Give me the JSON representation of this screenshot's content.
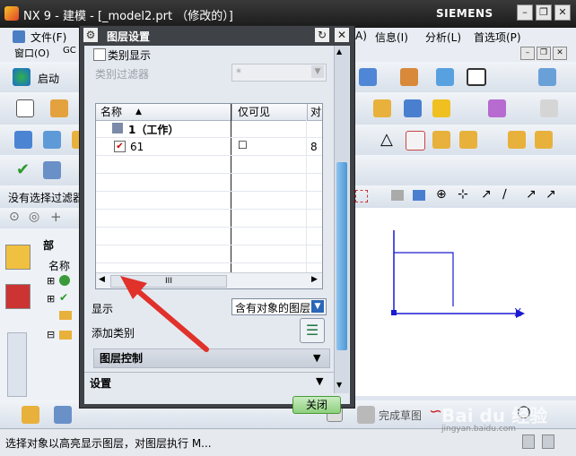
{
  "window": {
    "title": "NX 9 - 建模 - [_model2.prt （修改的）]",
    "brand": "SIEMENS"
  },
  "menubar": {
    "row1": [
      "文件(F)",
      "信息(I)",
      "分析(L)",
      "首选项(P)"
    ],
    "row2": [
      "窗口(O)",
      "GC"
    ],
    "partial": "A)"
  },
  "toolbar": {
    "start_label": "启动"
  },
  "filter": {
    "label": "没有选择过滤器"
  },
  "navigator": {
    "title": "部",
    "column": "名称"
  },
  "dialog": {
    "title": "图层设置",
    "category_display": "类别显示",
    "category_filter_label": "类别过滤器",
    "category_filter_value": "*",
    "columns": [
      "名称",
      "仅可见",
      "对"
    ],
    "rows": [
      {
        "name": "1（工作）",
        "visible": "",
        "count": ""
      },
      {
        "name": "61",
        "visible": "☐",
        "count": "8"
      }
    ],
    "display_label": "显示",
    "display_value": "含有对象的图层",
    "add_category": "添加类别",
    "layer_control": "图层控制",
    "settings": "设置",
    "close_button": "关闭",
    "scroll_thumb": "III"
  },
  "bottom": {
    "finish_sketch": "完成草图"
  },
  "status": {
    "text": "选择对象以高亮显示图层，对图层执行 M..."
  },
  "canvas": {
    "axis_x": "X"
  },
  "watermark": {
    "site": "Bai du 经验",
    "url": "jingyan.baidu.com"
  }
}
